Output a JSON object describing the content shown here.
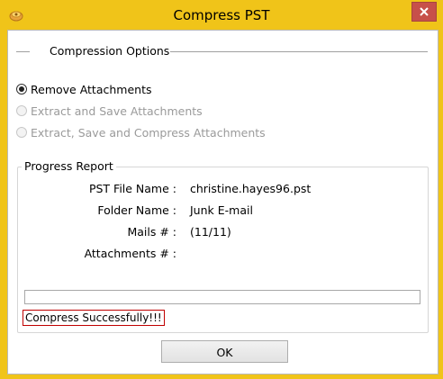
{
  "window": {
    "title": "Compress PST",
    "app_icon": "app-icon",
    "close_icon": "close-icon",
    "frame_color": "#f0c419",
    "close_color": "#c7504a"
  },
  "compression_options": {
    "title": "Compression Options",
    "options": [
      {
        "label": "Remove Attachments",
        "selected": true,
        "enabled": true
      },
      {
        "label": "Extract and Save Attachments",
        "selected": false,
        "enabled": false
      },
      {
        "label": "Extract, Save and Compress Attachments",
        "selected": false,
        "enabled": false
      }
    ]
  },
  "progress_report": {
    "title": "Progress Report",
    "pst_file_label": "PST File Name :",
    "pst_file_value": "christine.hayes96.pst",
    "folder_label": "Folder Name :",
    "folder_value": "Junk E-mail",
    "mails_label": "Mails # :",
    "mails_value": "(11/11)",
    "attachments_label": "Attachments # :",
    "attachments_value": "",
    "progress": 0
  },
  "status": {
    "message": "Compress Successfully!!!",
    "border_color": "#c00000"
  },
  "buttons": {
    "ok_label": "OK"
  }
}
